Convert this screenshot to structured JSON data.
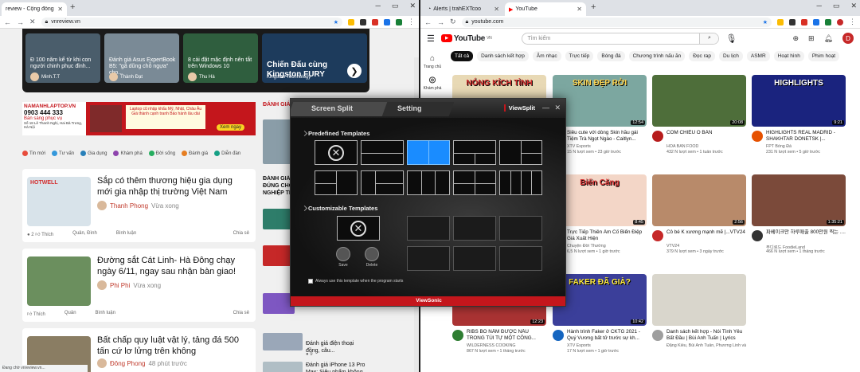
{
  "left": {
    "tab_title": "review - Cộng đồng đánh giá",
    "url": "vnreview.vn",
    "slider": [
      {
        "caption": "Đ 100 năm kể từ khi con người chinh phục đỉnh...",
        "author": "Minh.T.T",
        "color": "#4a5d6b"
      },
      {
        "caption": "Đánh giá Asus ExpertBook B5: \"gã dũng chỗ ngựa\" cho...",
        "author": "Thành Đạt",
        "color": "#7a8a96"
      },
      {
        "caption": "8 cài đặt mặc định nên tắt trên Windows 10",
        "author": "Thu Hà",
        "color": "#2f5e3e"
      },
      {
        "caption": "Chiến Đấu cùng Kingston FURY",
        "author": "Kingston Technology",
        "color": "#1d3b5c"
      }
    ],
    "banner": {
      "site": "NAMANHLAPTOP.VN",
      "phone": "0903 444 333",
      "tag": "Bán sàng phục vụ",
      "address": "Số 18 Lê Thanh Nghị, Hai Bà Trưng, Hà Nội",
      "promo": "Laptop cũ nhập khẩu Mỹ, Nhật, Châu Âu Giá thành cạnh tranh Bảo hành lâu dài",
      "cta": "Xem ngay"
    },
    "catnav": [
      {
        "label": "Tin mới",
        "color": "#e74c3c"
      },
      {
        "label": "Tư vấn",
        "color": "#3498db"
      },
      {
        "label": "Gia dụng",
        "color": "#2980b9"
      },
      {
        "label": "Khám phá",
        "color": "#8e44ad"
      },
      {
        "label": "Đời sống",
        "color": "#27ae60"
      },
      {
        "label": "Đánh giá",
        "color": "#e67e22"
      },
      {
        "label": "Diễn đàn",
        "color": "#16a085"
      }
    ],
    "articles": [
      {
        "title": "Sắp có thêm thương hiệu gia dụng mới gia nhập thị trường Việt Nam",
        "author": "Thanh Phong",
        "time": "Vừa xong",
        "likes": "2",
        "like_label": "Thích",
        "reactors": "Quân, Đình",
        "comment": "Bình luận",
        "share": "Chia sẻ",
        "color": "#d8e3ea"
      },
      {
        "title": "Đường sắt Cát Linh- Hà Đông chạy ngày 6/11, ngay sau nhận bàn giao!",
        "author": "Phi Phi",
        "time": "Vừa xong",
        "likes": "",
        "like_label": "Thích",
        "reactors": "Quân",
        "comment": "Bình luận",
        "share": "Chia sẻ",
        "color": "#6b8f5e"
      },
      {
        "title": "Bất chấp quy luật vật lý, tảng đá 500 tấn cứ lơ lửng trên không",
        "author": "Đông Phong",
        "time": "48 phút trước",
        "likes": "",
        "like_label": "",
        "reactors": "",
        "comment": "",
        "share": "",
        "color": "#8a7d63"
      }
    ],
    "side": {
      "head": "ĐÁNH GIÁ",
      "item1": "ĐÁNH GIÁ ĐÚNG CHỖ NGHIỆP TH",
      "item2": "Đánh giá iPhone 13 Pro Max: Siêu phẩm không dành cho số đông",
      "item3": "Đánh giá điện thoại đồng, câu...",
      "count1": "9",
      "count2": "8"
    },
    "status": "Đang chờ vnreview.vn..."
  },
  "right": {
    "tab_inactive": "Alerts | trahEXTcoo",
    "tab_title": "YouTube",
    "url": "youtube.com",
    "logo": "YouTube",
    "region": "VN",
    "search_placeholder": "Tìm kiếm",
    "avatar_letter": "D",
    "side_items": [
      "Trang chủ",
      "Khám phá"
    ],
    "chips": [
      "Tất cả",
      "Danh sách kết hợp",
      "Âm nhạc",
      "Trực tiếp",
      "Bóng đá",
      "Chương trình nấu ăn",
      "Đọc rap",
      "Du lịch",
      "ASMR",
      "Hoạt hình",
      "Phim hoạt"
    ],
    "videos": [
      {
        "title": "",
        "channel": "",
        "meta": "",
        "dur": "",
        "color": "#e8d9b5",
        "overlay": "NÓNG KÍCH TÌNH",
        "ocolor": "#d32f2f",
        "avc": "#888"
      },
      {
        "title": "Siêu cute với dòng Skin hầu gái Tiệm Trà Ngọt Ngào - Caitlyn...",
        "channel": "XTV Esports",
        "meta": "15 N lượt xem • 23 giờ trước",
        "dur": "12:54",
        "color": "#7ca7a0",
        "overlay": "SKIN ĐẸP RỜI",
        "ocolor": "#ffd54f",
        "avc": "#1565c0"
      },
      {
        "title": "COM CHIÊU Ô BẢN",
        "channel": "HOA BAN FOOD",
        "meta": "432 N lượt xem • 1 tuần trước",
        "dur": "20:08",
        "color": "#4e6e3a",
        "overlay": "",
        "ocolor": "#fff",
        "avc": "#b71c1c"
      },
      {
        "title": "HIGHLIGHTS REAL MADRID - SHAKHTAR DONETSK |...",
        "channel": "FPT Bóng Đá",
        "meta": "231 N lượt xem • 5 giờ trước",
        "dur": "9:21",
        "color": "#1a237e",
        "overlay": "HIGHLIGHTS",
        "ocolor": "#fff",
        "avc": "#e65100"
      },
      {
        "title": "Chế BẾP Cháy • Dầu Ăn Phế Thải & Nhớt THAY THẾ Cho GA...",
        "channel": "Lê Văn Lộc",
        "meta": "62 N lượt xem • 15 giờ trước",
        "dur": "12:10",
        "color": "#c98b5a",
        "overlay": "",
        "ocolor": "#fff",
        "avc": "#6d4c41"
      },
      {
        "title": "Trực Tiếp Thiên Âm Cố Biển Điệp Giá Xuất Hiện",
        "channel": "Chuyện Đời Thường",
        "meta": "6,5 N lượt xem • 1 giờ trước",
        "dur": "8:45",
        "color": "#f3d6c7",
        "overlay": "Biến Căng",
        "ocolor": "#d32f2f",
        "avc": "#9e9e9e"
      },
      {
        "title": "Cô bé K xương mạnh mẽ |...VTV24",
        "channel": "VTV24",
        "meta": "379 N lượt xem • 3 ngày trước",
        "dur": "2:56",
        "color": "#b88a6a",
        "overlay": "",
        "ocolor": "#fff",
        "avc": "#c62828"
      },
      {
        "title": "파베이크만 하루매출 800만원 찍는 ....",
        "channel": "푸디로드 FoodieLand",
        "meta": "466 N lượt xem • 1 tháng trước",
        "dur": "1:35:21",
        "color": "#7b4a3a",
        "overlay": "",
        "ocolor": "#fff",
        "avc": "#333"
      },
      {
        "title": "RIBS BÒ NẤM ĐƯỢC NẤU TRONG TÚI TỰ MỘT CÔNG...",
        "channel": "WILDERNESS COOKING",
        "meta": "867 N lượt xem • 1 tháng trước",
        "dur": "12:23",
        "color": "#a33",
        "overlay": "",
        "ocolor": "#fff",
        "avc": "#2e7d32"
      },
      {
        "title": "Hành trình Faker ở CKTG 2021 - Quý Vương bất tử trước sự kh...",
        "channel": "XTV Esports",
        "meta": "17 N lượt xem • 1 giờ trước",
        "dur": "10:42",
        "color": "#3b3f9a",
        "overlay": "FAKER ĐÃ GIÀ?",
        "ocolor": "#ffeb3b",
        "avc": "#1565c0"
      },
      {
        "title": "Danh sách kết hợp - Nói Tình Yêu Bất Đầu | Bùi Anh Tuấn | Lyrics Video",
        "channel": "Đặng Kiều, Bùi Anh Tuấn, Phương Linh và nhiều",
        "meta": "",
        "dur": "",
        "color": "#d9d6cc",
        "overlay": "",
        "ocolor": "#111",
        "avc": "#9e9e9e"
      }
    ]
  },
  "viewsplit": {
    "tab1": "Screen Split",
    "tab2": "Setting",
    "brand": "ViewSplit",
    "sec1": "Predefined Templates",
    "sec2": "Customizable Templates",
    "save": "Save",
    "delete": "Delete",
    "checkbox": "Always use this template when the program starts",
    "footer": "ViewSonic"
  }
}
